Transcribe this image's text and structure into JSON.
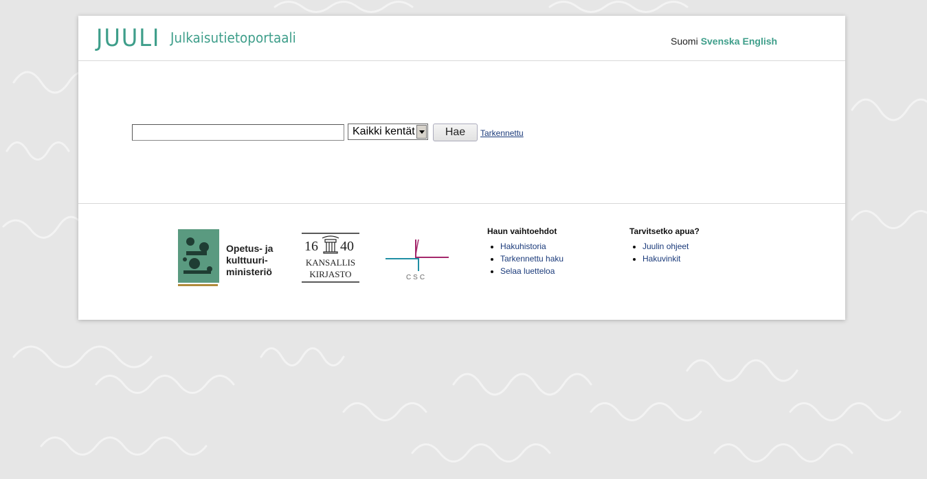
{
  "header": {
    "logo": "JUULI",
    "portal_title": "Julkaisutietoportaali",
    "languages": {
      "current": "Suomi",
      "others": [
        "Svenska",
        "English"
      ]
    },
    "brand_color": "#3e9e8a"
  },
  "search": {
    "input_value": "",
    "field_selected": "Kaikki kentät",
    "button_label": "Hae",
    "advanced_link": "Tarkennettu"
  },
  "footer": {
    "logos": {
      "okm": "Opetus- ja kulttuuri-ministeriö",
      "okm_lines": [
        "Opetus- ja",
        "kulttuuri-",
        "ministeriö"
      ],
      "kk_year": "1640",
      "kk_lines": [
        "KANSALLIS",
        "KIRJASTO"
      ],
      "csc": "CSC"
    },
    "search_options": {
      "heading": "Haun vaihtoehdot",
      "items": [
        "Hakuhistoria",
        "Tarkennettu haku",
        "Selaa luetteloa"
      ]
    },
    "help": {
      "heading": "Tarvitsetko apua?",
      "items": [
        "Juulin ohjeet",
        "Hakuvinkit"
      ]
    }
  }
}
